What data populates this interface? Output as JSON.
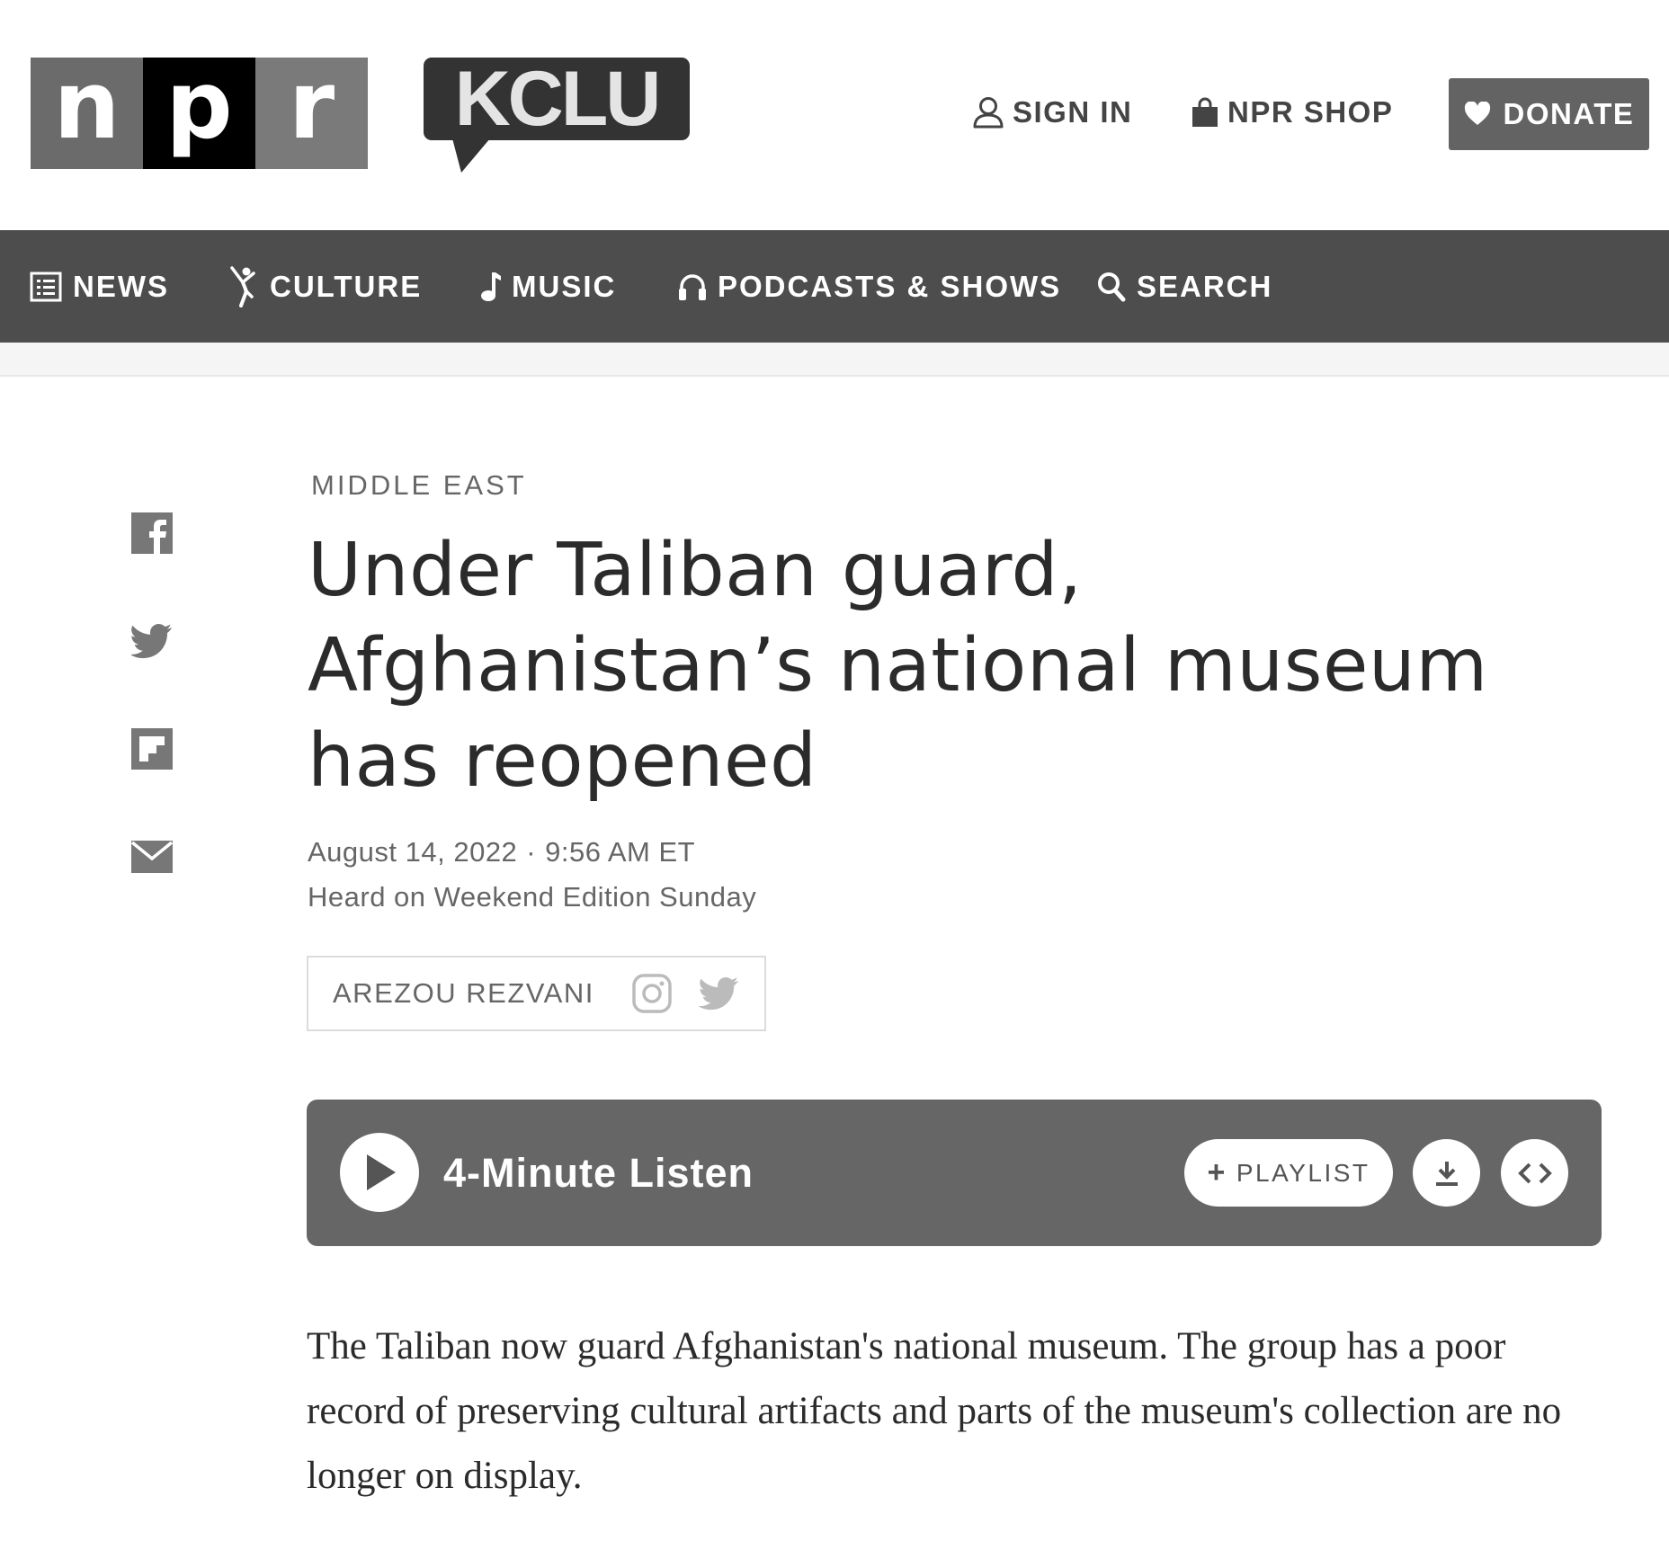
{
  "header": {
    "npr_letters": [
      "n",
      "p",
      "r"
    ],
    "station_logo": "KCLU",
    "sign_in": "SIGN IN",
    "shop": "NPR SHOP",
    "donate": "DONATE"
  },
  "nav": {
    "items": [
      {
        "label": "NEWS",
        "icon": "list-icon"
      },
      {
        "label": "CULTURE",
        "icon": "dancer-icon"
      },
      {
        "label": "MUSIC",
        "icon": "music-note-icon"
      },
      {
        "label": "PODCASTS & SHOWS",
        "icon": "headphones-icon"
      },
      {
        "label": "SEARCH",
        "icon": "search-icon"
      }
    ]
  },
  "share": [
    "facebook-icon",
    "twitter-icon",
    "flipboard-icon",
    "email-icon"
  ],
  "article": {
    "slug": "MIDDLE EAST",
    "headline_lines": [
      "Under Taliban guard,",
      "Afghanistan’s national museum",
      "has reopened"
    ],
    "date": "August 14, 2022",
    "time": "9:56 AM ET",
    "program": "Heard on Weekend Edition Sunday",
    "byline": "AREZOU REZVANI",
    "teaser": "The Taliban now guard Afghanistan's national museum. The group has a poor record of preserving cultural artifacts and parts of the museum's collection are no longer on display."
  },
  "audio": {
    "title": "4-Minute Listen",
    "playlist": "PLAYLIST"
  },
  "colors": {
    "nav_bg": "#4d4d4d",
    "audio_bg": "#666666",
    "donate_bg": "#636363"
  }
}
